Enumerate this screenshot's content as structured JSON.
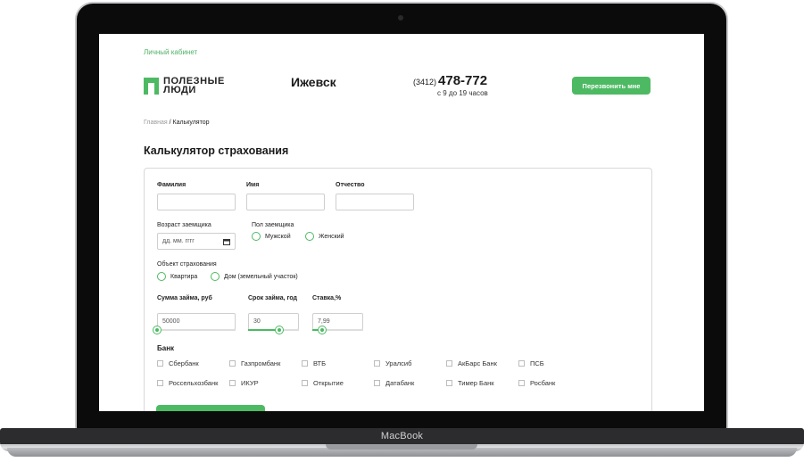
{
  "device": {
    "brand": "MacBook"
  },
  "header": {
    "cabinet_link": "Личный кабинет",
    "logo_line1": "ПОЛЕЗНЫЕ",
    "logo_line2": "ЛЮДИ",
    "city": "Ижевск",
    "phone_code": "(3412)",
    "phone_number": "478-772",
    "hours": "с 9 до 19 часов",
    "callback_button": "Перезвонить мне"
  },
  "breadcrumb": {
    "home": "Главная",
    "separator": " / ",
    "current": "Калькулятор"
  },
  "page_title": "Калькулятор страхования",
  "form": {
    "surname_label": "Фамилия",
    "name_label": "Имя",
    "patronymic_label": "Отчество",
    "age_label": "Возраст заемщика",
    "date_placeholder": "дд. мм. гггг",
    "gender_label": "Пол заемщика",
    "gender_options": [
      "Мужской",
      "Женский"
    ],
    "object_label": "Объект страхования",
    "object_options": [
      "Квартира",
      "Дом (земельный участок)"
    ],
    "loan_amount_label": "Сумма займа, руб",
    "loan_amount_value": "50000",
    "loan_amount_level": 0,
    "loan_term_label": "Срок займа, год",
    "loan_term_value": "30",
    "loan_term_level": 0.62,
    "rate_label": "Ставка,%",
    "rate_value": "7,99",
    "rate_level": 0.2,
    "bank_label": "Банк",
    "banks": [
      "Сбербанк",
      "Газпромбанк",
      "ВТБ",
      "Уралсиб",
      "АкБарс Банк",
      "ПСБ",
      "Россельхозбанк",
      "ИКУР",
      "Открытие",
      "Датабанк",
      "Тимер Банк",
      "Росбанк"
    ]
  },
  "colors": {
    "accent": "#4dba63",
    "text": "#1a1a1a",
    "border": "#d8d8d8"
  }
}
